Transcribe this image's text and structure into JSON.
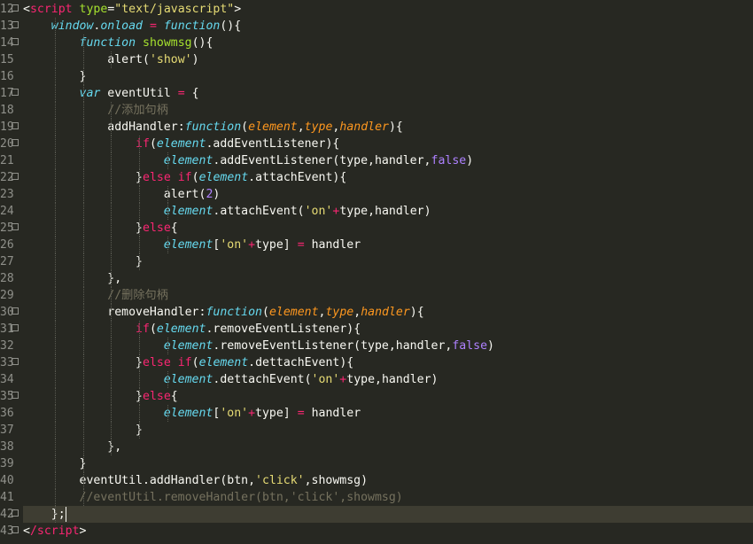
{
  "theme": {
    "background": "#272822",
    "line_number_color": "#8f908a",
    "active_line": "#3e3d32"
  },
  "editor": {
    "lines": [
      {
        "number": "12",
        "fold": true,
        "tokens": [
          {
            "t": "<",
            "c": "plain"
          },
          {
            "t": "script",
            "c": "tag"
          },
          {
            "t": " ",
            "c": "plain"
          },
          {
            "t": "type",
            "c": "attr"
          },
          {
            "t": "=",
            "c": "plain"
          },
          {
            "t": "\"text/javascript\"",
            "c": "str"
          },
          {
            "t": ">",
            "c": "plain"
          }
        ]
      },
      {
        "number": "13",
        "fold": true,
        "tokens": [
          {
            "t": "    ",
            "c": "plain"
          },
          {
            "t": "window",
            "c": "kw"
          },
          {
            "t": ".",
            "c": "plain"
          },
          {
            "t": "onload",
            "c": "kw"
          },
          {
            "t": " = ",
            "c": "op"
          },
          {
            "t": "function",
            "c": "kw"
          },
          {
            "t": "(){",
            "c": "plain"
          }
        ]
      },
      {
        "number": "14",
        "fold": true,
        "tokens": [
          {
            "t": "        ",
            "c": "plain"
          },
          {
            "t": "function",
            "c": "kw"
          },
          {
            "t": " ",
            "c": "plain"
          },
          {
            "t": "showmsg",
            "c": "fn"
          },
          {
            "t": "(){",
            "c": "plain"
          }
        ]
      },
      {
        "number": "15",
        "fold": false,
        "tokens": [
          {
            "t": "            ",
            "c": "plain"
          },
          {
            "t": "alert",
            "c": "plain"
          },
          {
            "t": "(",
            "c": "plain"
          },
          {
            "t": "'show'",
            "c": "str"
          },
          {
            "t": ")",
            "c": "plain"
          }
        ]
      },
      {
        "number": "16",
        "fold": false,
        "tokens": [
          {
            "t": "        ",
            "c": "plain"
          },
          {
            "t": "}",
            "c": "plain"
          }
        ]
      },
      {
        "number": "17",
        "fold": true,
        "tokens": [
          {
            "t": "        ",
            "c": "plain"
          },
          {
            "t": "var",
            "c": "kw"
          },
          {
            "t": " eventUtil ",
            "c": "plain"
          },
          {
            "t": "=",
            "c": "op"
          },
          {
            "t": " {",
            "c": "plain"
          }
        ]
      },
      {
        "number": "18",
        "fold": false,
        "tokens": [
          {
            "t": "            ",
            "c": "plain"
          },
          {
            "t": "//添加句柄",
            "c": "comment"
          }
        ]
      },
      {
        "number": "19",
        "fold": true,
        "tokens": [
          {
            "t": "            ",
            "c": "plain"
          },
          {
            "t": "addHandler",
            "c": "plain"
          },
          {
            "t": ":",
            "c": "plain"
          },
          {
            "t": "function",
            "c": "kw"
          },
          {
            "t": "(",
            "c": "plain"
          },
          {
            "t": "element",
            "c": "param"
          },
          {
            "t": ",",
            "c": "plain"
          },
          {
            "t": "type",
            "c": "param"
          },
          {
            "t": ",",
            "c": "plain"
          },
          {
            "t": "handler",
            "c": "param"
          },
          {
            "t": "){",
            "c": "plain"
          }
        ]
      },
      {
        "number": "20",
        "fold": true,
        "tokens": [
          {
            "t": "                ",
            "c": "plain"
          },
          {
            "t": "if",
            "c": "kw2"
          },
          {
            "t": "(",
            "c": "plain"
          },
          {
            "t": "element",
            "c": "kw"
          },
          {
            "t": ".addEventListener){",
            "c": "plain"
          }
        ]
      },
      {
        "number": "21",
        "fold": false,
        "tokens": [
          {
            "t": "                    ",
            "c": "plain"
          },
          {
            "t": "element",
            "c": "kw"
          },
          {
            "t": ".addEventListener(type,handler,",
            "c": "plain"
          },
          {
            "t": "false",
            "c": "const"
          },
          {
            "t": ")",
            "c": "plain"
          }
        ]
      },
      {
        "number": "22",
        "fold": true,
        "tokens": [
          {
            "t": "                ",
            "c": "plain"
          },
          {
            "t": "}",
            "c": "plain"
          },
          {
            "t": "else",
            "c": "kw2"
          },
          {
            "t": " ",
            "c": "plain"
          },
          {
            "t": "if",
            "c": "kw2"
          },
          {
            "t": "(",
            "c": "plain"
          },
          {
            "t": "element",
            "c": "kw"
          },
          {
            "t": ".attachEvent){",
            "c": "plain"
          }
        ]
      },
      {
        "number": "23",
        "fold": false,
        "tokens": [
          {
            "t": "                    ",
            "c": "plain"
          },
          {
            "t": "alert",
            "c": "plain"
          },
          {
            "t": "(",
            "c": "plain"
          },
          {
            "t": "2",
            "c": "num"
          },
          {
            "t": ")",
            "c": "plain"
          }
        ]
      },
      {
        "number": "24",
        "fold": false,
        "tokens": [
          {
            "t": "                    ",
            "c": "plain"
          },
          {
            "t": "element",
            "c": "kw"
          },
          {
            "t": ".attachEvent(",
            "c": "plain"
          },
          {
            "t": "'on'",
            "c": "str"
          },
          {
            "t": "+",
            "c": "op"
          },
          {
            "t": "type,handler)",
            "c": "plain"
          }
        ]
      },
      {
        "number": "25",
        "fold": true,
        "tokens": [
          {
            "t": "                ",
            "c": "plain"
          },
          {
            "t": "}",
            "c": "plain"
          },
          {
            "t": "else",
            "c": "kw2"
          },
          {
            "t": "{",
            "c": "plain"
          }
        ]
      },
      {
        "number": "26",
        "fold": false,
        "tokens": [
          {
            "t": "                    ",
            "c": "plain"
          },
          {
            "t": "element",
            "c": "kw"
          },
          {
            "t": "[",
            "c": "plain"
          },
          {
            "t": "'on'",
            "c": "str"
          },
          {
            "t": "+",
            "c": "op"
          },
          {
            "t": "type] ",
            "c": "plain"
          },
          {
            "t": "=",
            "c": "op"
          },
          {
            "t": " handler",
            "c": "plain"
          }
        ]
      },
      {
        "number": "27",
        "fold": false,
        "tokens": [
          {
            "t": "                ",
            "c": "plain"
          },
          {
            "t": "}",
            "c": "plain"
          }
        ]
      },
      {
        "number": "28",
        "fold": false,
        "tokens": [
          {
            "t": "            ",
            "c": "plain"
          },
          {
            "t": "},",
            "c": "plain"
          }
        ]
      },
      {
        "number": "29",
        "fold": false,
        "tokens": [
          {
            "t": "            ",
            "c": "plain"
          },
          {
            "t": "//删除句柄",
            "c": "comment"
          }
        ]
      },
      {
        "number": "30",
        "fold": true,
        "tokens": [
          {
            "t": "            ",
            "c": "plain"
          },
          {
            "t": "removeHandler",
            "c": "plain"
          },
          {
            "t": ":",
            "c": "plain"
          },
          {
            "t": "function",
            "c": "kw"
          },
          {
            "t": "(",
            "c": "plain"
          },
          {
            "t": "element",
            "c": "param"
          },
          {
            "t": ",",
            "c": "plain"
          },
          {
            "t": "type",
            "c": "param"
          },
          {
            "t": ",",
            "c": "plain"
          },
          {
            "t": "handler",
            "c": "param"
          },
          {
            "t": "){",
            "c": "plain"
          }
        ]
      },
      {
        "number": "31",
        "fold": true,
        "tokens": [
          {
            "t": "                ",
            "c": "plain"
          },
          {
            "t": "if",
            "c": "kw2"
          },
          {
            "t": "(",
            "c": "plain"
          },
          {
            "t": "element",
            "c": "kw"
          },
          {
            "t": ".removeEventListener){",
            "c": "plain"
          }
        ]
      },
      {
        "number": "32",
        "fold": false,
        "tokens": [
          {
            "t": "                    ",
            "c": "plain"
          },
          {
            "t": "element",
            "c": "kw"
          },
          {
            "t": ".removeEventListener(type,handler,",
            "c": "plain"
          },
          {
            "t": "false",
            "c": "const"
          },
          {
            "t": ")",
            "c": "plain"
          }
        ]
      },
      {
        "number": "33",
        "fold": true,
        "tokens": [
          {
            "t": "                ",
            "c": "plain"
          },
          {
            "t": "}",
            "c": "plain"
          },
          {
            "t": "else",
            "c": "kw2"
          },
          {
            "t": " ",
            "c": "plain"
          },
          {
            "t": "if",
            "c": "kw2"
          },
          {
            "t": "(",
            "c": "plain"
          },
          {
            "t": "element",
            "c": "kw"
          },
          {
            "t": ".dettachEvent){",
            "c": "plain"
          }
        ]
      },
      {
        "number": "34",
        "fold": false,
        "tokens": [
          {
            "t": "                    ",
            "c": "plain"
          },
          {
            "t": "element",
            "c": "kw"
          },
          {
            "t": ".dettachEvent(",
            "c": "plain"
          },
          {
            "t": "'on'",
            "c": "str"
          },
          {
            "t": "+",
            "c": "op"
          },
          {
            "t": "type,handler)",
            "c": "plain"
          }
        ]
      },
      {
        "number": "35",
        "fold": true,
        "tokens": [
          {
            "t": "                ",
            "c": "plain"
          },
          {
            "t": "}",
            "c": "plain"
          },
          {
            "t": "else",
            "c": "kw2"
          },
          {
            "t": "{",
            "c": "plain"
          }
        ]
      },
      {
        "number": "36",
        "fold": false,
        "tokens": [
          {
            "t": "                    ",
            "c": "plain"
          },
          {
            "t": "element",
            "c": "kw"
          },
          {
            "t": "[",
            "c": "plain"
          },
          {
            "t": "'on'",
            "c": "str"
          },
          {
            "t": "+",
            "c": "op"
          },
          {
            "t": "type] ",
            "c": "plain"
          },
          {
            "t": "=",
            "c": "op"
          },
          {
            "t": " handler",
            "c": "plain"
          }
        ]
      },
      {
        "number": "37",
        "fold": false,
        "tokens": [
          {
            "t": "                ",
            "c": "plain"
          },
          {
            "t": "}",
            "c": "plain"
          }
        ]
      },
      {
        "number": "38",
        "fold": false,
        "tokens": [
          {
            "t": "            ",
            "c": "plain"
          },
          {
            "t": "},",
            "c": "plain"
          }
        ]
      },
      {
        "number": "39",
        "fold": false,
        "tokens": [
          {
            "t": "        ",
            "c": "plain"
          },
          {
            "t": "}",
            "c": "plain"
          }
        ]
      },
      {
        "number": "40",
        "fold": false,
        "tokens": [
          {
            "t": "        ",
            "c": "plain"
          },
          {
            "t": "eventUtil.addHandler(btn,",
            "c": "plain"
          },
          {
            "t": "'click'",
            "c": "str"
          },
          {
            "t": ",showmsg)",
            "c": "plain"
          }
        ]
      },
      {
        "number": "41",
        "fold": false,
        "tokens": [
          {
            "t": "        ",
            "c": "plain"
          },
          {
            "t": "//eventUtil.removeHandler(btn,'click',showmsg)",
            "c": "comment"
          }
        ]
      },
      {
        "number": "42",
        "fold": true,
        "active": true,
        "tokens": [
          {
            "t": "    ",
            "c": "plain"
          },
          {
            "t": "};",
            "c": "plain"
          }
        ]
      },
      {
        "number": "43",
        "fold": true,
        "tokens": [
          {
            "t": "<",
            "c": "plain"
          },
          {
            "t": "/script",
            "c": "tag"
          },
          {
            "t": ">",
            "c": "plain"
          }
        ]
      }
    ]
  }
}
